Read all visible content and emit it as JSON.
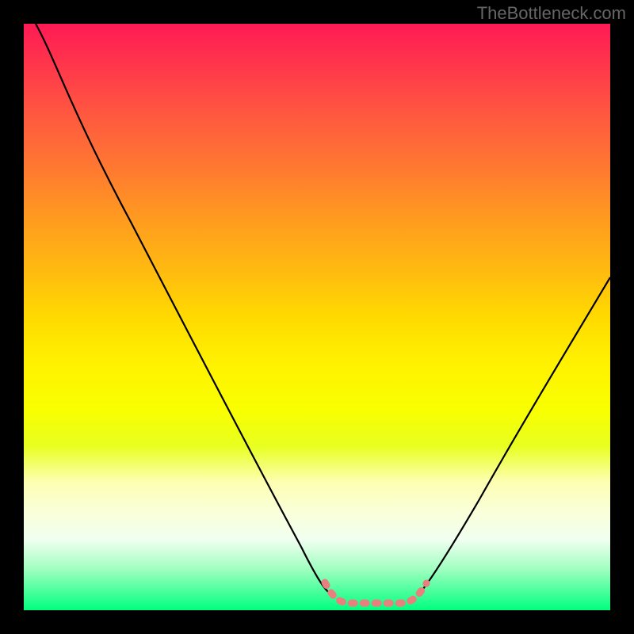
{
  "watermark": "TheBottleneck.com",
  "chart_data": {
    "type": "line",
    "title": "",
    "xlabel": "",
    "ylabel": "",
    "xlim": [
      0,
      100
    ],
    "ylim": [
      0,
      100
    ],
    "series": [
      {
        "name": "left-curve",
        "stroke": "#000000",
        "points": [
          {
            "x": 2,
            "y": 100
          },
          {
            "x": 9,
            "y": 91
          },
          {
            "x": 18,
            "y": 74
          },
          {
            "x": 28,
            "y": 54
          },
          {
            "x": 38,
            "y": 32
          },
          {
            "x": 46,
            "y": 14
          },
          {
            "x": 50,
            "y": 6
          },
          {
            "x": 52,
            "y": 3
          }
        ]
      },
      {
        "name": "right-curve",
        "stroke": "#000000",
        "points": [
          {
            "x": 67,
            "y": 3
          },
          {
            "x": 70,
            "y": 7
          },
          {
            "x": 75,
            "y": 15
          },
          {
            "x": 82,
            "y": 28
          },
          {
            "x": 90,
            "y": 44
          },
          {
            "x": 97,
            "y": 58
          },
          {
            "x": 100,
            "y": 63
          }
        ]
      },
      {
        "name": "bottom-highlight",
        "stroke": "#e88080",
        "points": [
          {
            "x": 51,
            "y": 5
          },
          {
            "x": 53,
            "y": 2
          },
          {
            "x": 55,
            "y": 1
          },
          {
            "x": 60,
            "y": 1
          },
          {
            "x": 64,
            "y": 1
          },
          {
            "x": 66,
            "y": 2
          },
          {
            "x": 68,
            "y": 5
          }
        ]
      }
    ],
    "gradient_stops": [
      {
        "pos": 0,
        "color": "#ff1a55"
      },
      {
        "pos": 50,
        "color": "#ffda00"
      },
      {
        "pos": 100,
        "color": "#00ff7f"
      }
    ]
  }
}
